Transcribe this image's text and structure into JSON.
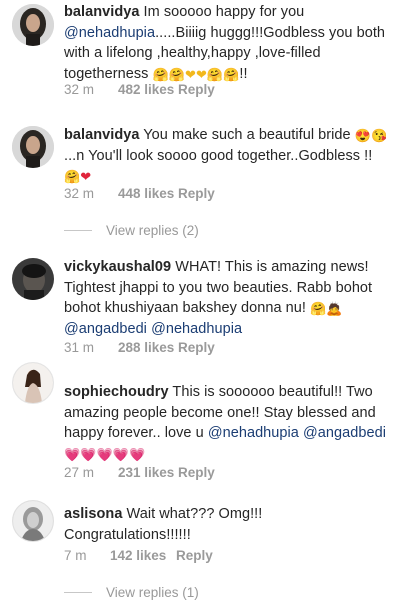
{
  "comments": [
    {
      "username": "balanvidya",
      "parts": [
        "Im sooooo happy for you",
        "@nehadhupia",
        ".....Biiiig huggg!!!Godbless you both with a lifelong ,healthy,happy ,love-filled togetherness",
        "🤗🤗❤❤🤗🤗",
        "!!"
      ],
      "time": "32 m",
      "likes": "482 likes",
      "reply": "Reply"
    },
    {
      "username": "balanvidya",
      "parts": [
        "You make such a beautiful bride",
        "😍😘",
        "...n You'll look soooo good together..Godbless !!",
        "🤗❤"
      ],
      "time": "32 m",
      "likes": "448 likes",
      "reply": "Reply",
      "view_replies": "View replies (2)"
    },
    {
      "username": "vickykaushal09",
      "parts": [
        "WHAT! This is amazing news! Tightest jhappi to you two beauties. Rabb bohot bohot khushiyaan bakshey donna nu!",
        "🤗🙇",
        "@angadbedi",
        "@nehadhupia"
      ],
      "time": "31 m",
      "likes": "288 likes",
      "reply": "Reply"
    },
    {
      "username": "sophiechoudry",
      "parts": [
        "This is soooooo beautiful!! Two amazing people become one!! Stay blessed and happy forever.. love u",
        "@nehadhupia",
        "@angadbedi",
        "💗💗💗💗💗"
      ],
      "time": "27 m",
      "likes": "231 likes",
      "reply": "Reply"
    },
    {
      "username": "aslisona",
      "parts": [
        "Wait what??? Omg!!! Congratulations!!!!!!"
      ],
      "time": "7 m",
      "likes": "142 likes",
      "reply": "Reply",
      "view_replies": "View replies (1)"
    }
  ],
  "colors": {
    "text": "#262626",
    "meta": "#999999",
    "mention": "#1b3d73",
    "background": "#ffffff"
  }
}
